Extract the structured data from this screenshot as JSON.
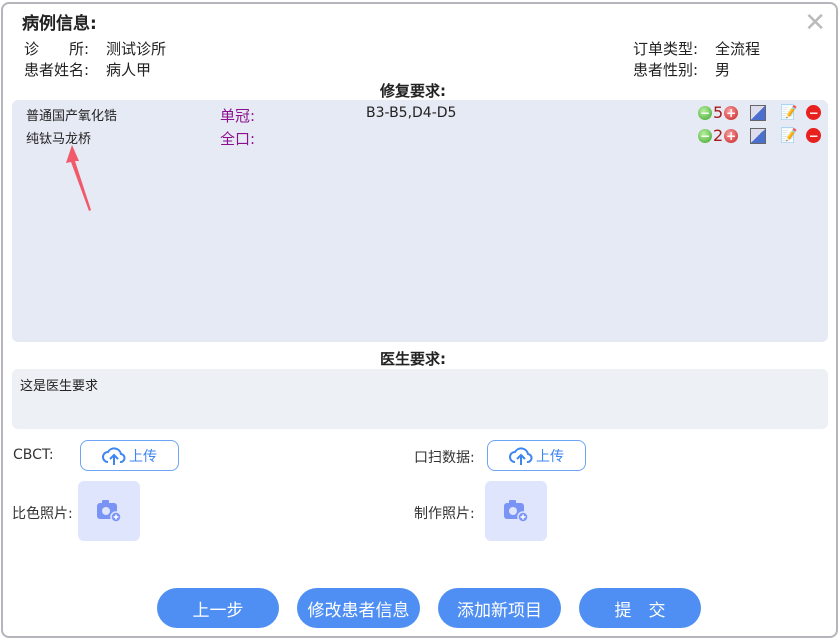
{
  "header": {
    "title": "病例信息:",
    "close_icon": "close-icon"
  },
  "info": {
    "clinic_label": "诊　　所:",
    "clinic": "测试诊所",
    "patient_label": "患者姓名:",
    "patient": "病人甲",
    "order_type_label": "订单类型:",
    "order_type": "全流程",
    "gender_label": "患者性别:",
    "gender": "男"
  },
  "repair": {
    "title": "修复要求:",
    "items": [
      {
        "material": "普通国产氧化锆",
        "type": "单冠:",
        "teeth": "B3-B5,D4-D5",
        "qty": "5"
      },
      {
        "material": "纯钛马龙桥",
        "type": "全口:",
        "teeth": "",
        "qty": "2"
      }
    ]
  },
  "doctor": {
    "title": "医生要求:",
    "text": "这是医生要求"
  },
  "uploads": {
    "cbct_label": "CBCT:",
    "scan_label": "口扫数据:",
    "upload_label": "上传",
    "shade_label": "比色照片:",
    "made_label": "制作照片:"
  },
  "buttons": {
    "prev": "上一步",
    "edit": "修改患者信息",
    "add": "添加新项目",
    "submit": "提　交"
  },
  "colors": {
    "accent": "#4f8ff3",
    "type": "#8b0f8f",
    "annotation_arrow": "#f05a6a"
  }
}
